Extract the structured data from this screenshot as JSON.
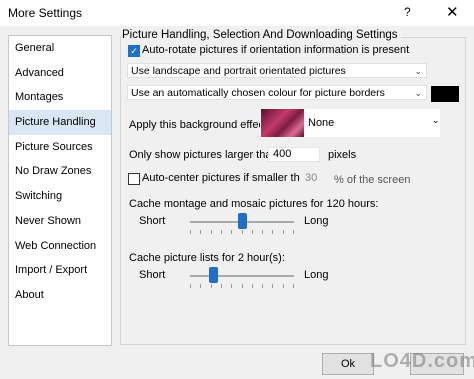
{
  "window": {
    "title": "More Settings",
    "help_icon": "?",
    "close_icon": "✕"
  },
  "sidebar": {
    "items": [
      {
        "label": "General"
      },
      {
        "label": "Advanced"
      },
      {
        "label": "Montages"
      },
      {
        "label": "Picture Handling",
        "selected": true
      },
      {
        "label": "Picture Sources"
      },
      {
        "label": "No Draw Zones"
      },
      {
        "label": "Switching"
      },
      {
        "label": "Never Shown"
      },
      {
        "label": "Web Connection"
      },
      {
        "label": "Import / Export"
      },
      {
        "label": "About"
      }
    ]
  },
  "panel": {
    "group_title": "Picture Handling, Selection And Downloading Settings",
    "auto_rotate": {
      "label": "Auto-rotate pictures if orientation information is present",
      "checked": true
    },
    "orientation_select": {
      "value": "Use landscape and portrait orientated pictures"
    },
    "border_colour_select": {
      "value": "Use an automatically chosen colour for picture borders",
      "swatch_color": "#000000"
    },
    "background_effect": {
      "label": "Apply this background effect:",
      "value": "None"
    },
    "min_size": {
      "label": "Only show pictures larger than:",
      "value": "400",
      "unit": "pixels"
    },
    "auto_center": {
      "label": "Auto-center pictures if smaller than:",
      "checked": false,
      "value": "30",
      "unit": "% of the screen"
    },
    "cache_montage": {
      "label": "Cache montage and mosaic pictures for 120 hours:",
      "min_label": "Short",
      "max_label": "Long",
      "level": 0.5
    },
    "cache_lists": {
      "label": "Cache picture lists for 2 hour(s):",
      "min_label": "Short",
      "max_label": "Long",
      "level": 0.2
    }
  },
  "footer": {
    "ok_label": "Ok"
  },
  "watermark": "LO4D.com",
  "colors": {
    "accent": "#1f6fc5",
    "selected_bg": "#d9e6f4"
  }
}
